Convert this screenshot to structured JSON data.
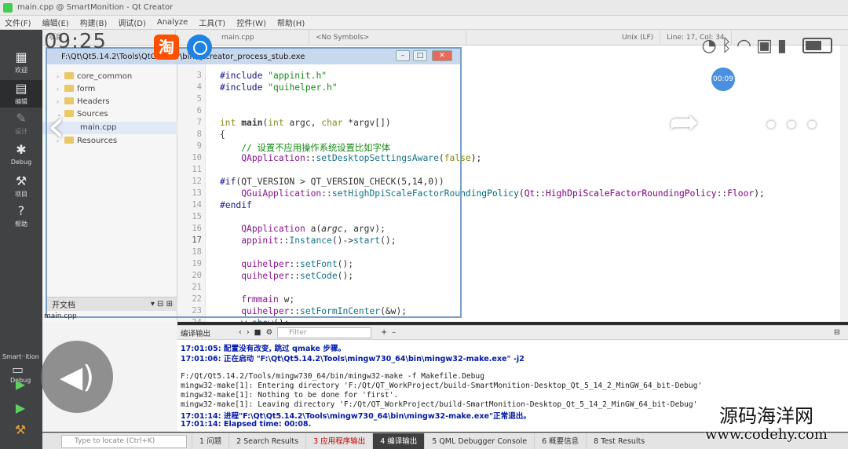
{
  "window": {
    "title": "main.cpp @ SmartMonition - Qt Creator"
  },
  "menu": [
    "文件(F)",
    "编辑(E)",
    "构建(B)",
    "调试(D)",
    "Analyze",
    "工具(T)",
    "控件(W)",
    "帮助(H)"
  ],
  "toolbar": {
    "project_label": "项目",
    "file_tab": "main.cpp",
    "symbols": "<No Symbols>",
    "encoding": "Unix (LF)",
    "position": "Line: 17, Col: 34"
  },
  "modes": [
    {
      "label": "欢迎"
    },
    {
      "label": "编辑"
    },
    {
      "label": "设计"
    },
    {
      "label": "Debug"
    },
    {
      "label": "项目"
    },
    {
      "label": "帮助"
    }
  ],
  "kit": {
    "name": "Smart··ition",
    "mode": "Debug"
  },
  "project_tree": [
    {
      "label": "core_common",
      "folder": true
    },
    {
      "label": "form",
      "folder": true
    },
    {
      "label": "Headers",
      "folder": true
    },
    {
      "label": "Sources",
      "folder": true
    },
    {
      "label": "main.cpp",
      "folder": false
    },
    {
      "label": "Resources",
      "folder": true
    }
  ],
  "open_docs": {
    "label": "开文档",
    "item": "main.cpp"
  },
  "process_window": {
    "title": "F:\\Qt\\Qt5.14.2\\Tools\\QtCreator\\bin\\qtcreator_process_stub.exe"
  },
  "editor": {
    "line_numbers": [
      "3",
      "4",
      "5",
      "6",
      "7",
      "8",
      "9",
      "10",
      "11",
      "12",
      "13",
      "14",
      "15",
      "16",
      "17",
      "18",
      "19",
      "20",
      "21",
      "22",
      "23",
      "24"
    ]
  },
  "output": {
    "title": "编译输出",
    "filter_placeholder": "Filter",
    "lines": [
      "17:01:05: 配置没有改变, 跳过 qmake 步骤。",
      "17:01:06: 正在启动 \"F:\\Qt\\Qt5.14.2\\Tools\\mingw730_64\\bin\\mingw32-make.exe\" -j2",
      "",
      "F:/Qt/Qt5.14.2/Tools/mingw730_64/bin/mingw32-make -f Makefile.Debug",
      "mingw32-make[1]: Entering directory 'F:/Qt/QT_WorkProject/build-SmartMonition-Desktop_Qt_5_14_2_MinGW_64_bit-Debug'",
      "mingw32-make[1]: Nothing to be done for 'first'.",
      "mingw32-make[1]: Leaving directory 'F:/Qt/QT_WorkProject/build-SmartMonition-Desktop_Qt_5_14_2_MinGW_64_bit-Debug'",
      "17:01:14: 进程\"F:\\Qt\\Qt5.14.2\\Tools\\mingw730_64\\bin\\mingw32-make.exe\"正常退出。",
      "17:01:14: Elapsed time: 00:08."
    ]
  },
  "statusbar": {
    "locator_placeholder": "Type to locate (Ctrl+K)",
    "tabs": [
      "1 问题",
      "2 Search Results",
      "3 应用程序输出",
      "4 编译输出",
      "5 QML Debugger Console",
      "6 概要信息",
      "8 Test Results"
    ]
  },
  "phone_overlay": {
    "clock": "09:25",
    "taobao_glyph": "淘",
    "record_timer": "00:09",
    "watermark_line1": "源码海洋网",
    "watermark_line2": "www.codehy.com"
  },
  "colors": {
    "accent_output_text": "#0018a8",
    "active_tab": "#3e3e3e",
    "modebar": "#404244"
  }
}
